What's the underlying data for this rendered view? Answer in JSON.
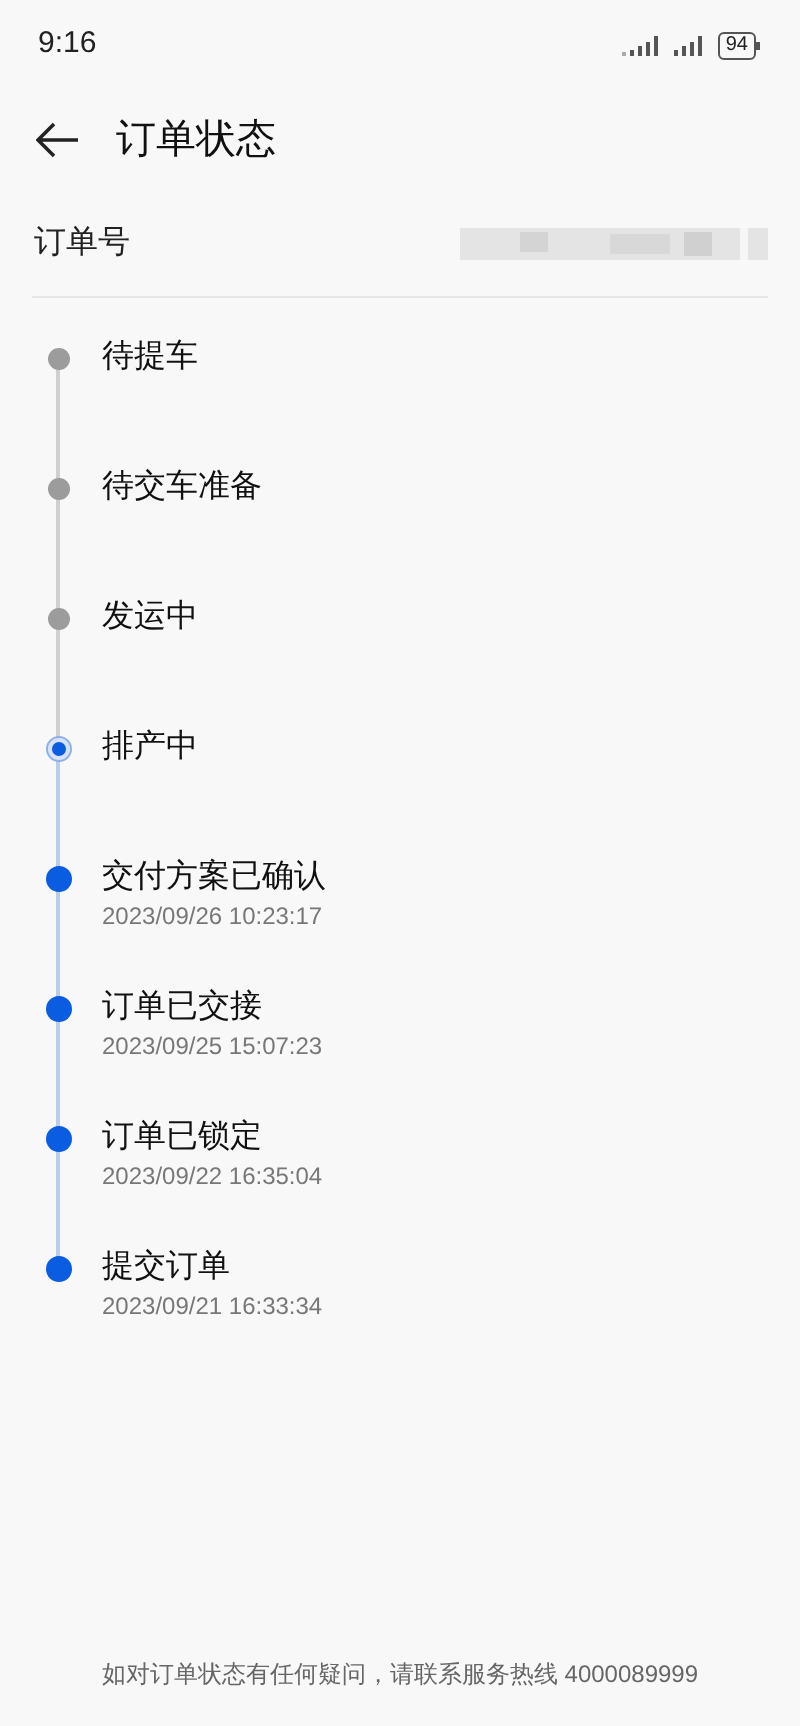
{
  "status_bar": {
    "time": "9:16",
    "battery": "94"
  },
  "header": {
    "title": "订单状态"
  },
  "order": {
    "label": "订单号"
  },
  "steps": [
    {
      "title": "待提车",
      "kind": "pending"
    },
    {
      "title": "待交车准备",
      "kind": "pending"
    },
    {
      "title": "发运中",
      "kind": "pending"
    },
    {
      "title": "排产中",
      "kind": "current"
    },
    {
      "title": "交付方案已确认",
      "kind": "done",
      "time": "2023/09/26 10:23:17"
    },
    {
      "title": "订单已交接",
      "kind": "done",
      "time": "2023/09/25 15:07:23"
    },
    {
      "title": "订单已锁定",
      "kind": "done",
      "time": "2023/09/22 16:35:04"
    },
    {
      "title": "提交订单",
      "kind": "done",
      "time": "2023/09/21 16:33:34"
    }
  ],
  "footer": {
    "note": "如对订单状态有任何疑问，请联系服务热线 4000089999"
  }
}
